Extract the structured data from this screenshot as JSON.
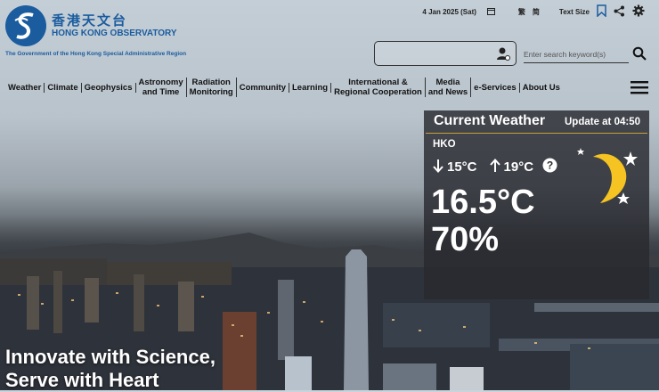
{
  "header": {
    "logo_zh": "香港天文台",
    "logo_en": "HONG KONG OBSERVATORY",
    "gov_line": "The Government of the Hong Kong Special Administrative Region"
  },
  "utility": {
    "date": "4 Jan 2025 (Sat)",
    "lang_tc": "繁",
    "lang_sc": "简",
    "text_size": "Text Size"
  },
  "search": {
    "placeholder": "Enter search keyword(s)"
  },
  "nav": {
    "items": [
      "Weather",
      "Climate",
      "Geophysics",
      "Astronomy\nand Time",
      "Radiation\nMonitoring",
      "Community",
      "Learning",
      "International &\nRegional Cooperation",
      "Media\nand News",
      "e-Services",
      "About Us"
    ]
  },
  "weather": {
    "title": "Current Weather",
    "update": "Update at 04:50",
    "station": "HKO",
    "min": "15°C",
    "max": "19°C",
    "temperature": "16.5°C",
    "humidity": "70%",
    "icon": "moon-stars-icon"
  },
  "slogan": "Innovate with Science,\nServe with Heart"
}
